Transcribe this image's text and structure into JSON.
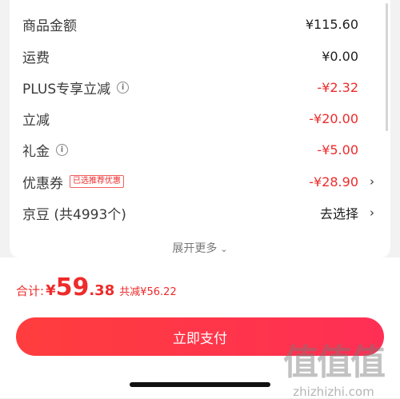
{
  "summary": {
    "rows": [
      {
        "label": "商品金额",
        "value": "¥115.60"
      },
      {
        "label": "运费",
        "value": "¥0.00"
      },
      {
        "label": "PLUS专享立减",
        "value": "-¥2.32"
      },
      {
        "label": "立减",
        "value": "-¥20.00"
      },
      {
        "label": "礼金",
        "value": "-¥5.00"
      },
      {
        "label": "优惠券",
        "tag": "已选推荐优惠",
        "value": "-¥28.90"
      },
      {
        "label": "京豆 (共4993个)",
        "value": "去选择"
      }
    ],
    "expand_label": "展开更多"
  },
  "footer": {
    "total_label": "合计:",
    "currency": "¥",
    "total_int": "59",
    "total_dec": ".38",
    "saved_text": "共减¥56.22",
    "pay_button": "立即支付"
  },
  "watermark": {
    "logo": "值值值",
    "url": "zhizhizhi.com"
  },
  "colors": {
    "accent": "#ee2b2b",
    "button_start": "#ff3d3d",
    "button_end": "#ff2f55"
  },
  "icons": [
    "info-icon",
    "chevron-right-icon",
    "chevron-down-icon"
  ]
}
